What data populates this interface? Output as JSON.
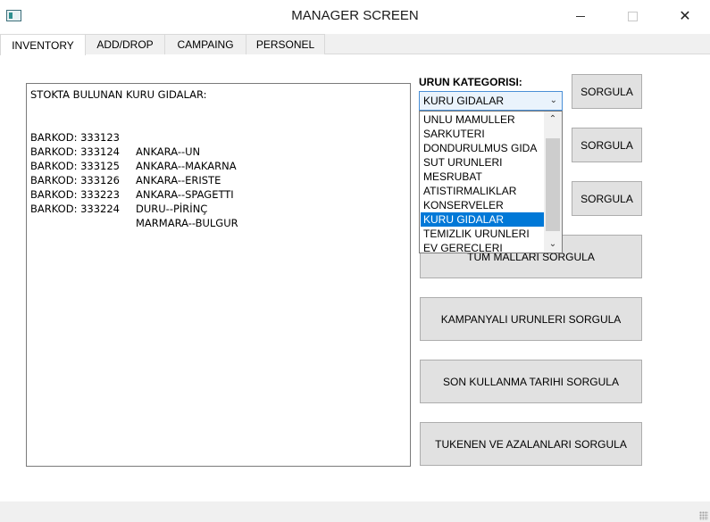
{
  "window": {
    "title": "MANAGER SCREEN",
    "close_glyph": "✕"
  },
  "tabs": [
    {
      "label": "INVENTORY",
      "active": true
    },
    {
      "label": "ADD/DROP",
      "active": false
    },
    {
      "label": "CAMPAING",
      "active": false
    },
    {
      "label": "PERSONEL",
      "active": false
    }
  ],
  "inventory": {
    "output": {
      "header": "STOKTA BULUNAN KURU GIDALAR:",
      "rows": [
        {
          "barcode": "BARKOD: 333123",
          "product": "ANKARA--UN"
        },
        {
          "barcode": "BARKOD: 333124",
          "product": "ANKARA--MAKARNA"
        },
        {
          "barcode": "BARKOD: 333125",
          "product": "ANKARA--ERISTE"
        },
        {
          "barcode": "BARKOD: 333126",
          "product": "ANKARA--SPAGETTI"
        },
        {
          "barcode": "BARKOD: 333223",
          "product": "DURU--PİRİNÇ"
        },
        {
          "barcode": "BARKOD: 333224",
          "product": "MARMARA--BULGUR"
        }
      ]
    },
    "category_label": "URUN KATEGORISI:",
    "category_combo": {
      "selected": "KURU GIDALAR",
      "options": [
        "UNLU MAMULLER",
        "SARKUTERI",
        "DONDURULMUS GIDA",
        "SUT URUNLERI",
        "MESRUBAT",
        "ATISTIRMALIKLAR",
        "KONSERVELER",
        "KURU GIDALAR",
        "TEMIZLIK URUNLERI",
        "EV GERECLERI"
      ]
    },
    "buttons": {
      "sorgula_1": "SORGULA",
      "sorgula_2": "SORGULA",
      "sorgula_3": "SORGULA",
      "all_products": "TUM MALLARI SORGULA",
      "campaign_products": "KAMPANYALI URUNLERI SORGULA",
      "expiry_date": "SON KULLANMA TARIHI SORGULA",
      "low_stock": "TUKENEN VE AZALANLARI SORGULA"
    }
  },
  "colors": {
    "selection": "#0078d7",
    "button_bg": "#e1e1e1",
    "tab_bg": "#f0f0f0",
    "combo_border": "#4a8fd6"
  },
  "icons": {
    "app": "app-window-icon",
    "minimize": "minimize-icon",
    "maximize": "maximize-icon",
    "close": "close-icon",
    "combo_arrow": "chevron-down-icon",
    "scroll_up": "chevron-up-icon",
    "scroll_down": "chevron-down-icon"
  }
}
